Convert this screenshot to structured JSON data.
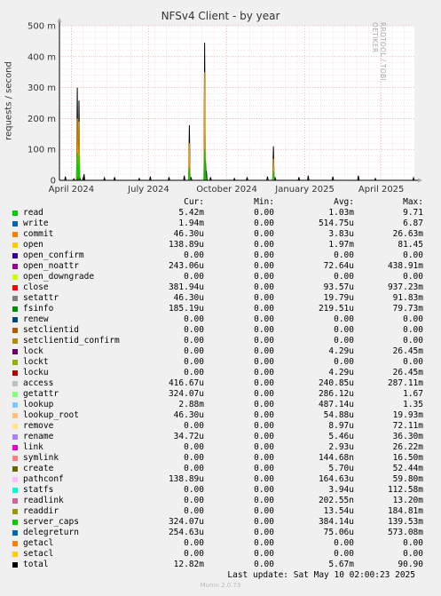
{
  "chart_data": {
    "type": "line",
    "title": "NFSv4 Client - by year",
    "ylabel": "requests / second",
    "side_label": "RRDTOOL / TOBI OETIKER",
    "ylim": [
      0,
      500
    ],
    "y_ticks": [
      {
        "v": 0,
        "label": "0"
      },
      {
        "v": 100,
        "label": "100 m"
      },
      {
        "v": 200,
        "label": "200 m"
      },
      {
        "v": 300,
        "label": "300 m"
      },
      {
        "v": 400,
        "label": "400 m"
      },
      {
        "v": 500,
        "label": "500 m"
      }
    ],
    "x_ticks": [
      "April 2024",
      "July 2024",
      "October 2024",
      "January 2025",
      "April 2025"
    ],
    "x_tick_dates": [
      "2024-04-01",
      "2024-07-01",
      "2024-10-01",
      "2025-01-01",
      "2025-04-01"
    ],
    "x_range": [
      "2024-03-18",
      "2025-05-10"
    ],
    "grid": true,
    "series": [
      {
        "name": "total",
        "color": "#000000",
        "points": [
          [
            "2024-03-25",
            12
          ],
          [
            "2024-04-04",
            5
          ],
          [
            "2024-04-08",
            300
          ],
          [
            "2024-04-09",
            20
          ],
          [
            "2024-04-10",
            258
          ],
          [
            "2024-04-11",
            10
          ],
          [
            "2024-04-15",
            8
          ],
          [
            "2024-04-16",
            20
          ],
          [
            "2024-05-10",
            8
          ],
          [
            "2024-05-22",
            10
          ],
          [
            "2024-06-20",
            6
          ],
          [
            "2024-07-03",
            12
          ],
          [
            "2024-07-25",
            10
          ],
          [
            "2024-08-12",
            15
          ],
          [
            "2024-08-18",
            178
          ],
          [
            "2024-08-20",
            10
          ],
          [
            "2024-09-05",
            445
          ],
          [
            "2024-09-06",
            65
          ],
          [
            "2024-09-07",
            30
          ],
          [
            "2024-09-12",
            10
          ],
          [
            "2024-10-10",
            6
          ],
          [
            "2024-10-25",
            10
          ],
          [
            "2024-11-18",
            12
          ],
          [
            "2024-11-25",
            110
          ],
          [
            "2024-11-27",
            8
          ],
          [
            "2024-12-25",
            10
          ],
          [
            "2025-01-05",
            15
          ],
          [
            "2025-02-03",
            12
          ],
          [
            "2025-03-05",
            15
          ],
          [
            "2025-03-25",
            6
          ],
          [
            "2025-05-09",
            8
          ]
        ]
      },
      {
        "name": "commit",
        "color": "#f0a000",
        "points": [
          [
            "2024-04-08",
            200
          ],
          [
            "2024-04-10",
            190
          ],
          [
            "2024-08-18",
            120
          ],
          [
            "2024-09-05",
            350
          ],
          [
            "2024-09-06",
            30
          ],
          [
            "2024-11-25",
            70
          ]
        ]
      },
      {
        "name": "getattr",
        "color": "#00cc00",
        "points": [
          [
            "2024-04-08",
            90
          ],
          [
            "2024-04-10",
            80
          ],
          [
            "2024-08-18",
            40
          ],
          [
            "2024-09-05",
            100
          ],
          [
            "2024-09-06",
            30
          ],
          [
            "2024-11-25",
            30
          ]
        ]
      }
    ]
  },
  "legend": {
    "headers": {
      "cur": "Cur:",
      "min": "Min:",
      "avg": "Avg:",
      "max": "Max:"
    },
    "rows": [
      {
        "name": "read",
        "color": "#00cc00",
        "cur": "5.42m",
        "min": "0.00",
        "avg": "1.03m",
        "max": "9.71"
      },
      {
        "name": "write",
        "color": "#0066b3",
        "cur": "1.94m",
        "min": "0.00",
        "avg": "514.75u",
        "max": "6.87"
      },
      {
        "name": "commit",
        "color": "#ff8000",
        "cur": "46.30u",
        "min": "0.00",
        "avg": "3.83u",
        "max": "26.63m"
      },
      {
        "name": "open",
        "color": "#ffcc00",
        "cur": "138.89u",
        "min": "0.00",
        "avg": "1.97m",
        "max": "81.45"
      },
      {
        "name": "open_confirm",
        "color": "#330099",
        "cur": "0.00",
        "min": "0.00",
        "avg": "0.00",
        "max": "0.00"
      },
      {
        "name": "open_noattr",
        "color": "#990099",
        "cur": "243.06u",
        "min": "0.00",
        "avg": "72.64u",
        "max": "438.91m"
      },
      {
        "name": "open_downgrade",
        "color": "#ccff00",
        "cur": "0.00",
        "min": "0.00",
        "avg": "0.00",
        "max": "0.00"
      },
      {
        "name": "close",
        "color": "#ff0000",
        "cur": "381.94u",
        "min": "0.00",
        "avg": "93.57u",
        "max": "937.23m"
      },
      {
        "name": "setattr",
        "color": "#808080",
        "cur": "46.30u",
        "min": "0.00",
        "avg": "19.79u",
        "max": "91.83m"
      },
      {
        "name": "fsinfo",
        "color": "#008f00",
        "cur": "185.19u",
        "min": "0.00",
        "avg": "219.51u",
        "max": "79.73m"
      },
      {
        "name": "renew",
        "color": "#00487d",
        "cur": "0.00",
        "min": "0.00",
        "avg": "0.00",
        "max": "0.00"
      },
      {
        "name": "setclientid",
        "color": "#b35a00",
        "cur": "0.00",
        "min": "0.00",
        "avg": "0.00",
        "max": "0.00"
      },
      {
        "name": "setclientid_confirm",
        "color": "#b38f00",
        "cur": "0.00",
        "min": "0.00",
        "avg": "0.00",
        "max": "0.00"
      },
      {
        "name": "lock",
        "color": "#6b006b",
        "cur": "0.00",
        "min": "0.00",
        "avg": "4.29u",
        "max": "26.45m"
      },
      {
        "name": "lockt",
        "color": "#8fb300",
        "cur": "0.00",
        "min": "0.00",
        "avg": "0.00",
        "max": "0.00"
      },
      {
        "name": "locku",
        "color": "#b30000",
        "cur": "0.00",
        "min": "0.00",
        "avg": "4.29u",
        "max": "26.45m"
      },
      {
        "name": "access",
        "color": "#bebebe",
        "cur": "416.67u",
        "min": "0.00",
        "avg": "240.85u",
        "max": "287.11m"
      },
      {
        "name": "getattr",
        "color": "#80ff80",
        "cur": "324.07u",
        "min": "0.00",
        "avg": "286.12u",
        "max": "1.67"
      },
      {
        "name": "lookup",
        "color": "#80c9ff",
        "cur": "2.88m",
        "min": "0.00",
        "avg": "487.14u",
        "max": "1.35"
      },
      {
        "name": "lookup_root",
        "color": "#ffc080",
        "cur": "46.30u",
        "min": "0.00",
        "avg": "54.88u",
        "max": "19.93m"
      },
      {
        "name": "remove",
        "color": "#ffe680",
        "cur": "0.00",
        "min": "0.00",
        "avg": "8.97u",
        "max": "72.11m"
      },
      {
        "name": "rename",
        "color": "#aa80ff",
        "cur": "34.72u",
        "min": "0.00",
        "avg": "5.46u",
        "max": "36.30m"
      },
      {
        "name": "link",
        "color": "#ee00cc",
        "cur": "0.00",
        "min": "0.00",
        "avg": "2.93u",
        "max": "26.22m"
      },
      {
        "name": "symlink",
        "color": "#ff8080",
        "cur": "0.00",
        "min": "0.00",
        "avg": "144.68n",
        "max": "16.50m"
      },
      {
        "name": "create",
        "color": "#666600",
        "cur": "0.00",
        "min": "0.00",
        "avg": "5.70u",
        "max": "52.44m"
      },
      {
        "name": "pathconf",
        "color": "#ffbfff",
        "cur": "138.89u",
        "min": "0.00",
        "avg": "164.63u",
        "max": "59.80m"
      },
      {
        "name": "statfs",
        "color": "#00ffcc",
        "cur": "0.00",
        "min": "0.00",
        "avg": "3.94u",
        "max": "112.58m"
      },
      {
        "name": "readlink",
        "color": "#cc6699",
        "cur": "0.00",
        "min": "0.00",
        "avg": "202.55n",
        "max": "13.20m"
      },
      {
        "name": "readdir",
        "color": "#999900",
        "cur": "0.00",
        "min": "0.00",
        "avg": "13.54u",
        "max": "184.81m"
      },
      {
        "name": "server_caps",
        "color": "#00cc00",
        "cur": "324.07u",
        "min": "0.00",
        "avg": "384.14u",
        "max": "139.53m"
      },
      {
        "name": "delegreturn",
        "color": "#0066b3",
        "cur": "254.63u",
        "min": "0.00",
        "avg": "75.06u",
        "max": "573.08m"
      },
      {
        "name": "getacl",
        "color": "#ff8000",
        "cur": "0.00",
        "min": "0.00",
        "avg": "0.00",
        "max": "0.00"
      },
      {
        "name": "setacl",
        "color": "#ffcc00",
        "cur": "0.00",
        "min": "0.00",
        "avg": "0.00",
        "max": "0.00"
      },
      {
        "name": "total",
        "color": "#000000",
        "cur": "12.82m",
        "min": "0.00",
        "avg": "5.67m",
        "max": "90.90"
      }
    ]
  },
  "footer": {
    "last_update": "Last update: Sat May 10 02:00:23 2025",
    "generator": "Munin 2.0.73"
  }
}
